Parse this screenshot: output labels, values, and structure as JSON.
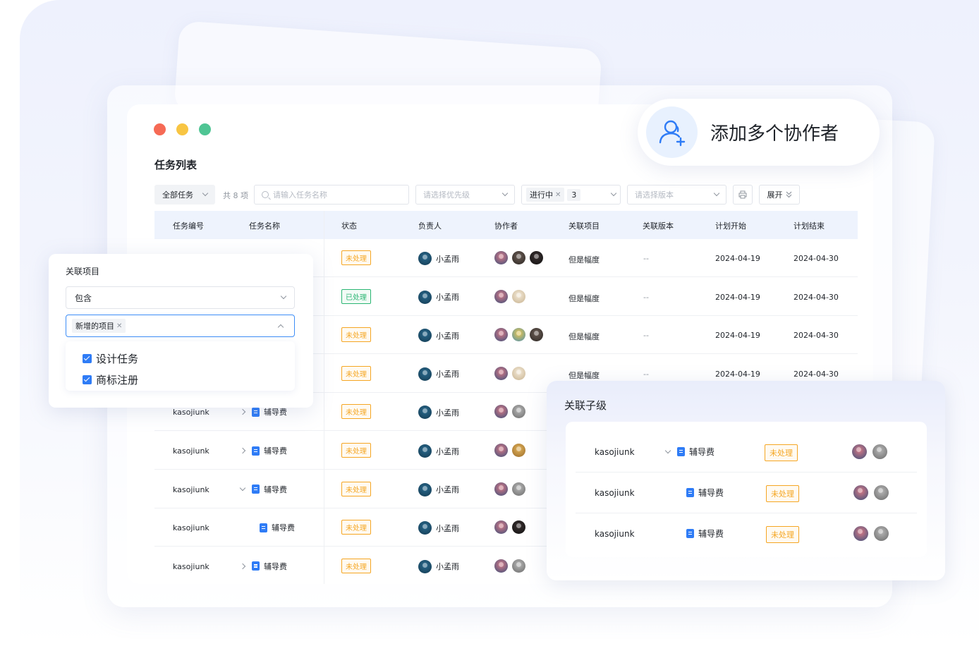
{
  "main_title": "任务列表",
  "toolbar": {
    "all_tasks": "全部任务",
    "count": "共 8 项",
    "search_placeholder": "请输入任务名称",
    "priority_placeholder": "请选择优先级",
    "status_tag": "进行中",
    "status_count": "3",
    "version_placeholder": "请选择版本",
    "expand": "展开"
  },
  "columns": [
    "任务编号",
    "任务名称",
    "状态",
    "负责人",
    "协作者",
    "关联项目",
    "关联版本",
    "计划开始",
    "计划结束"
  ],
  "rows": [
    {
      "code": "",
      "name": "",
      "expander": "",
      "status": "未处理",
      "owner": "小孟雨",
      "collabs": [
        "pink",
        "dark",
        "black"
      ],
      "project": "但是幅度",
      "version": "--",
      "start": "2024-04-19",
      "end": "2024-04-30"
    },
    {
      "code": "",
      "name": "",
      "expander": "",
      "status": "已处理",
      "owner": "小孟雨",
      "collabs": [
        "pink",
        "cream"
      ],
      "project": "但是幅度",
      "version": "--",
      "start": "2024-04-19",
      "end": "2024-04-30"
    },
    {
      "code": "",
      "name": "",
      "expander": "",
      "status": "未处理",
      "owner": "小孟雨",
      "collabs": [
        "pink",
        "yellow",
        "dark"
      ],
      "project": "但是幅度",
      "version": "--",
      "start": "2024-04-19",
      "end": "2024-04-30"
    },
    {
      "code": "",
      "name": "",
      "expander": "",
      "status": "未处理",
      "owner": "小孟雨",
      "collabs": [
        "pink",
        "cream"
      ],
      "project": "但是幅度",
      "version": "--",
      "start": "2024-04-19",
      "end": "2024-04-30"
    },
    {
      "code": "kasojiunk",
      "name": "辅导费",
      "expander": "right",
      "status": "未处理",
      "owner": "小孟雨",
      "collabs": [
        "pink",
        "grey"
      ],
      "project": "",
      "version": "",
      "start": "",
      "end": ""
    },
    {
      "code": "kasojiunk",
      "name": "辅导费",
      "expander": "right",
      "status": "未处理",
      "owner": "小孟雨",
      "collabs": [
        "pink",
        "gold"
      ],
      "project": "",
      "version": "",
      "start": "",
      "end": ""
    },
    {
      "code": "kasojiunk",
      "name": "辅导费",
      "expander": "down",
      "status": "未处理",
      "owner": "小孟雨",
      "collabs": [
        "pink",
        "grey"
      ],
      "project": "",
      "version": "",
      "start": "",
      "end": ""
    },
    {
      "code": "kasojiunk",
      "name": "辅导费",
      "expander": "none",
      "status": "未处理",
      "owner": "小孟雨",
      "collabs": [
        "pink",
        "black"
      ],
      "project": "",
      "version": "",
      "start": "",
      "end": ""
    },
    {
      "code": "kasojiunk",
      "name": "辅导费",
      "expander": "right",
      "status": "未处理",
      "owner": "小孟雨",
      "collabs": [
        "pink",
        "grey"
      ],
      "project": "",
      "version": "",
      "start": "",
      "end": ""
    }
  ],
  "collab_callout": {
    "text": "添加多个协作者",
    "icon": "add-user-icon"
  },
  "filter_panel": {
    "title": "关联项目",
    "operator": "包含",
    "selected_tag": "新增的项目",
    "options": [
      {
        "label": "设计任务",
        "checked": true
      },
      {
        "label": "商标注册",
        "checked": true
      }
    ]
  },
  "sub_panel": {
    "title": "关联子级",
    "rows": [
      {
        "code": "kasojiunk",
        "name": "辅导费",
        "expander": "down",
        "status": "未处理",
        "collabs": [
          "pink",
          "grey"
        ]
      },
      {
        "code": "kasojiunk",
        "name": "辅导费",
        "expander": "none",
        "status": "未处理",
        "collabs": [
          "pink",
          "grey"
        ]
      },
      {
        "code": "kasojiunk",
        "name": "辅导费",
        "expander": "none",
        "status": "未处理",
        "collabs": [
          "pink",
          "grey"
        ]
      }
    ]
  },
  "colors": {
    "accent": "#2f7cf6",
    "pending": "#f5a623",
    "done": "#2bb673",
    "header_bg": "#eef3fd"
  }
}
